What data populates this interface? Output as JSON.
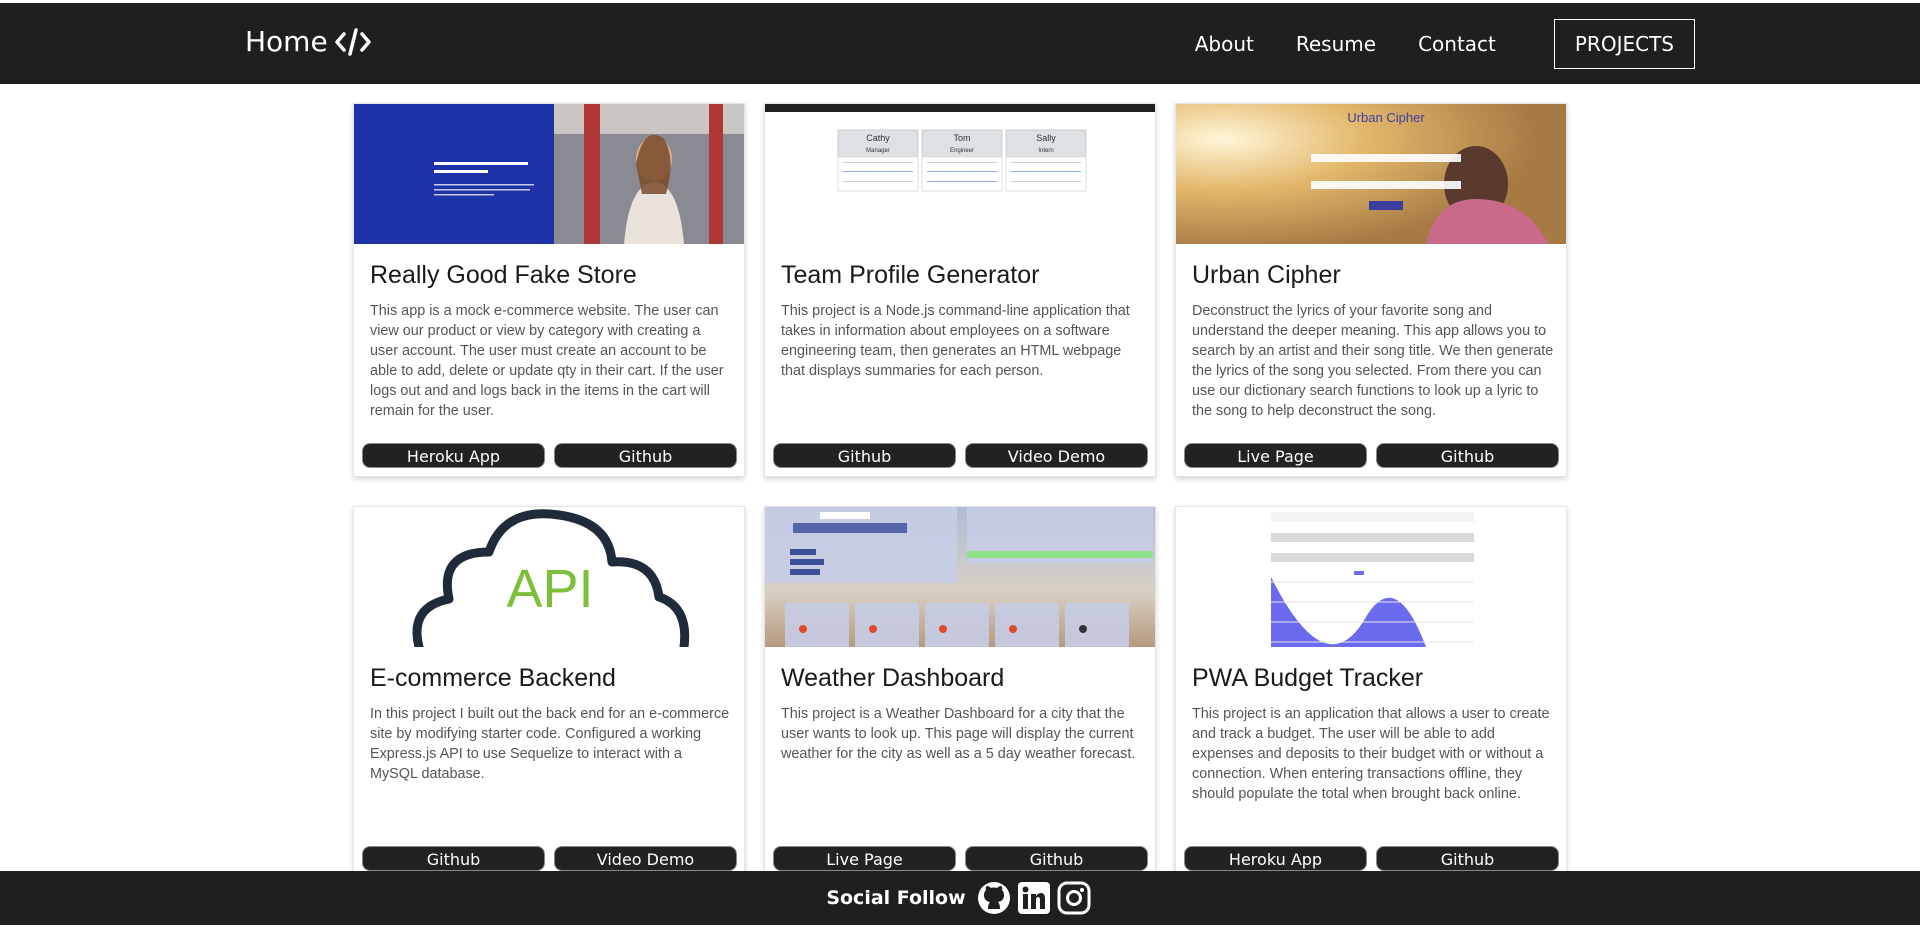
{
  "nav": {
    "brand": "Home",
    "links": [
      "About",
      "Resume",
      "Contact"
    ],
    "active": "PROJECTS"
  },
  "projects": [
    {
      "title": "Really Good Fake Store",
      "description": "This app is a mock e-commerce website. The user can view our product or view by category with creating a user account. The user must create an account to be able to add, delete or update qty in their cart. If the user logs out and and logs back in the items in the cart will remain for the user.",
      "buttons": [
        "Heroku App",
        "Github"
      ],
      "thumb_text": "Bringing fake brands and people together"
    },
    {
      "title": "Team Profile Generator",
      "description": "This project is a Node.js command-line application that takes in information about employees on a software engineering team, then generates an HTML webpage that displays summaries for each person.",
      "buttons": [
        "Github",
        "Video Demo"
      ],
      "thumb_names": [
        "Cathy",
        "Tom",
        "Sally"
      ],
      "thumb_roles": [
        "Manager",
        "Engineer",
        "Intern"
      ]
    },
    {
      "title": "Urban Cipher",
      "description": "Deconstruct the lyrics of your favorite song and understand the deeper meaning. This app allows you to search by an artist and their song title. We then generate the lyrics of the song you selected. From there you can use our dictionary search functions to look up a lyric to the song to help deconstruct the song.",
      "buttons": [
        "Live Page",
        "Github"
      ],
      "thumb_text": "Urban Cipher"
    },
    {
      "title": "E-commerce Backend",
      "description": "In this project I built out the back end for an e-commerce site by modifying starter code. Configured a working Express.js API to use Sequelize to interact with a MySQL database.",
      "buttons": [
        "Github",
        "Video Demo"
      ],
      "thumb_text": "API"
    },
    {
      "title": "Weather Dashboard",
      "description": "This project is a Weather Dashboard for a city that the user wants to look up. This page will display the current weather for the city as well as a 5 day weather forecast.",
      "buttons": [
        "Live Page",
        "Github"
      ],
      "thumb_days": [
        "Mon, June 14th",
        "Tue, June 15th",
        "Wed, June 16th",
        "Thu, June 17th",
        "Fri, June 18th"
      ]
    },
    {
      "title": "PWA Budget Tracker",
      "description": "This project is an application that allows a user to create and track a budget. The user will be able to add expenses and deposits to their budget with or without a connection. When entering transactions offline, they should populate the total when brought back online.",
      "buttons": [
        "Heroku App",
        "Github"
      ],
      "thumb_headers": [
        "Transaction",
        "Amount"
      ],
      "thumb_rows": [
        [
          "dinner",
          "-80"
        ],
        [
          "giftcard",
          "20"
        ],
        [
          "gas",
          "-50"
        ],
        [
          "payday",
          "1500"
        ]
      ]
    }
  ],
  "footer": {
    "label": "Social Follow",
    "icons": [
      "github-icon",
      "linkedin-icon",
      "instagram-icon"
    ]
  }
}
